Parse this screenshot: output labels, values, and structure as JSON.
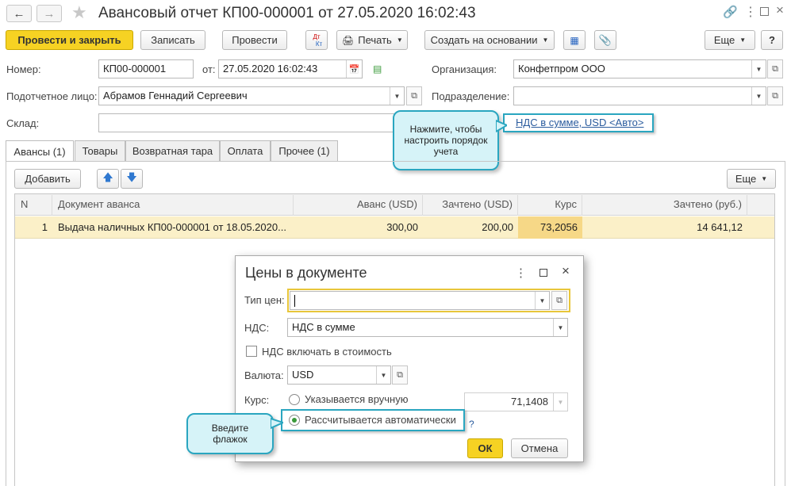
{
  "window": {
    "title": "Авансовый отчет КП00-000001 от 27.05.2020 16:02:43"
  },
  "toolbar": {
    "post_close": "Провести и закрыть",
    "save": "Записать",
    "post": "Провести",
    "dt_kt_top": "Дт",
    "dt_kt_bottom": "Кт",
    "print": "Печать",
    "create_based": "Создать на основании",
    "more": "Еще",
    "help": "?"
  },
  "form": {
    "number_label": "Номер:",
    "number_value": "КП00-000001",
    "from_label": "от:",
    "date_value": "27.05.2020 16:02:43",
    "org_label": "Организация:",
    "org_value": "Конфетпром ООО",
    "person_label": "Подотчетное лицо:",
    "person_value": "Абрамов Геннадий Сергеевич",
    "division_label": "Подразделение:",
    "division_value": "",
    "warehouse_label": "Склад:",
    "warehouse_value": "",
    "vat_link": "НДС в сумме, USD <Авто>"
  },
  "tabs": [
    {
      "label": "Авансы (1)"
    },
    {
      "label": "Товары"
    },
    {
      "label": "Возвратная тара"
    },
    {
      "label": "Оплата"
    },
    {
      "label": "Прочее (1)"
    }
  ],
  "table_toolbar": {
    "add": "Добавить",
    "more": "Еще"
  },
  "table": {
    "headers": [
      "N",
      "Документ аванса",
      "Аванс (USD)",
      "Зачтено (USD)",
      "Курс",
      "Зачтено (руб.)"
    ],
    "rows": [
      [
        "1",
        "Выдача наличных КП00-000001 от 18.05.2020...",
        "300,00",
        "200,00",
        "73,2056",
        "14 641,12"
      ]
    ]
  },
  "dialog": {
    "title": "Цены в документе",
    "price_type_label": "Тип цен:",
    "price_type_value": "",
    "vat_label": "НДС:",
    "vat_value": "НДС в сумме",
    "vat_include_label": "НДС включать в стоимость",
    "currency_label": "Валюта:",
    "currency_value": "USD",
    "rate_label": "Курс:",
    "rate_manual": "Указывается вручную",
    "rate_value": "71,1408",
    "rate_auto": "Рассчитывается автоматически",
    "help": "?",
    "ok": "ОК",
    "cancel": "Отмена"
  },
  "callouts": {
    "top": "Нажмите, чтобы настроить порядок учета",
    "bottom": "Введите флажок"
  },
  "colors": {
    "accent_yellow": "#f6d223",
    "row_highlight": "#fbf0c8",
    "callout_fill": "#d6f3f8",
    "callout_border": "#2aa6c0"
  }
}
